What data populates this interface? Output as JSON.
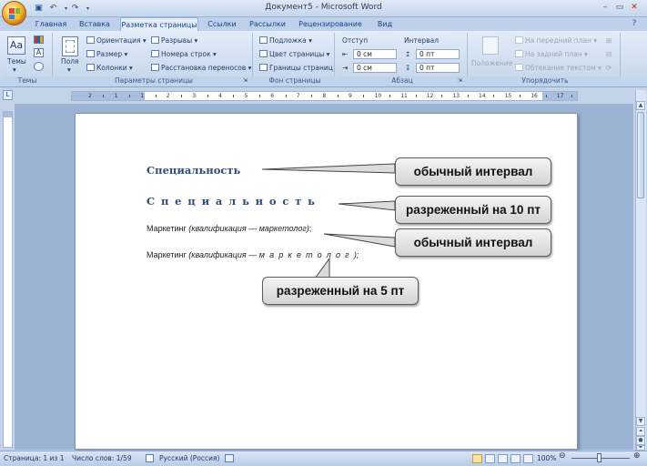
{
  "window": {
    "title": "Документ5 - Microsoft Word"
  },
  "tabs": [
    "Главная",
    "Вставка",
    "Разметка страницы",
    "Ссылки",
    "Рассылки",
    "Рецензирование",
    "Вид"
  ],
  "ribbon": {
    "themes": {
      "button": "Темы",
      "group": "Темы"
    },
    "page_setup": {
      "fields": "Поля",
      "orientation": "Ориентация",
      "size": "Размер",
      "columns": "Колонки",
      "breaks": "Разрывы",
      "line_numbers": "Номера строк",
      "hyphenation": "Расстановка переносов",
      "group": "Параметры страницы"
    },
    "page_background": {
      "watermark": "Подложка",
      "page_color": "Цвет страницы",
      "page_borders": "Границы страниц",
      "group": "Фон страницы"
    },
    "paragraph": {
      "indent_label": "Отступ",
      "spacing_label": "Интервал",
      "indent_left": "0 см",
      "indent_right": "0 см",
      "spacing_before": "0 пт",
      "spacing_after": "0 пт",
      "group": "Абзац"
    },
    "arrange": {
      "position": "Положение",
      "bring_front": "На передний план",
      "send_back": "На задний план",
      "text_wrap": "Обтекание текстом",
      "group": "Упорядочить"
    }
  },
  "ruler": {
    "numbers": [
      "2",
      "1",
      "1",
      "2",
      "3",
      "4",
      "5",
      "6",
      "7",
      "8",
      "9",
      "10",
      "11",
      "12",
      "13",
      "14",
      "15",
      "16",
      "17"
    ],
    "corner": "L"
  },
  "document": {
    "line1": "Специальность",
    "line2": "Специальность",
    "line3_plain": "Маркетинг ",
    "line3_italic": "(квалификация — маркетолог)",
    "line3_end": ";",
    "line4_plain": "Маркетинг ",
    "line4_italic": "(квалификация — ",
    "line4_spaced": "маркетолог",
    "line4_end": ");"
  },
  "callouts": {
    "c1": "обычный интервал",
    "c2": "разреженный на 10 пт",
    "c3": "обычный интервал",
    "c4": "разреженный на 5 пт"
  },
  "status": {
    "page": "Страница: 1 из 1",
    "words": "Число слов: 1/59",
    "language": "Русский (Россия)",
    "zoom": "100%"
  },
  "colors": {
    "accent": "#15428b",
    "ribbon": "#dbe6f4",
    "workspace": "#9cb2d2"
  }
}
